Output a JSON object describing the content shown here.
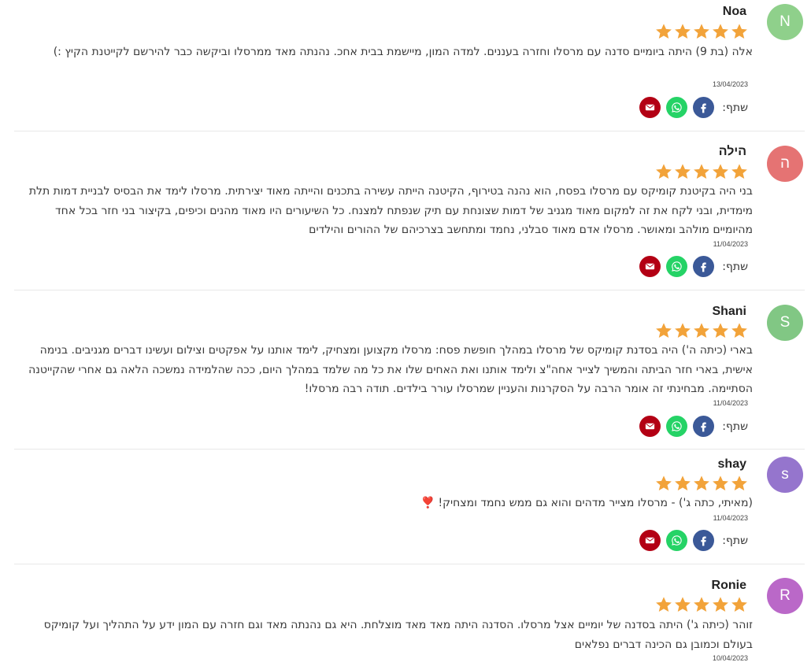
{
  "colors": {
    "star": "#f2a33a",
    "facebook": "#3b5998",
    "whatsapp": "#25d366",
    "email": "#b30014",
    "divider": "#e8e8e8"
  },
  "share_label": "שתף:",
  "reviews": [
    {
      "initial": "N",
      "avatar_color": "#8fd08b",
      "name": "Noa",
      "rating": 5,
      "text": "אלה (בת 9) היתה ביומיים סדנה עם מרסלו וחזרה בעננים. למדה המון, מיישמת בבית אחכ. נהנתה מאד ממרסלו וביקשה כבר להירשם לקייטנת הקיץ :)",
      "date": "13/04/2023"
    },
    {
      "initial": "ה",
      "avatar_color": "#e57373",
      "name": "הילה",
      "rating": 5,
      "text": "בני היה בקיטנת קומיקס עם מרסלו בפסח, הוא נהנה בטירוף, הקיטנה הייתה עשירה בתכנים והייתה מאוד יצירתית. מרסלו לימד את הבסיס לבניית דמות תלת מימדית, ובני לקח את זה למקום מאוד מגניב של דמות שצונחת עם תיק שנפתח למצנח. כל השיעורים היו מאוד מהנים וכיפים, בקיצור בני חזר בכל אחד מהיומיים מולהב ומאושר. מרסלו אדם מאוד סבלני, נחמד ומתחשב בצרכיהם של ההורים והילדים",
      "date": "11/04/2023"
    },
    {
      "initial": "S",
      "avatar_color": "#81c784",
      "name": "Shani",
      "rating": 5,
      "text": "בארי (כיתה ה') היה בסדנת קומיקס של מרסלו במהלך חופשת פסח: מרסלו מקצוען ומצחיק, לימד אותנו על אפקטים וצילום ועשינו דברים מגניבים. בנימה אישית, בארי חזר הביתה והמשיך לצייר אחה\"צ ולימד אותנו ואת האחים שלו את כל מה שלמד במהלך היום, ככה שהלמידה נמשכה הלאה גם אחרי שהקייטנה הסתיימה. מבחינתי זה אומר הרבה על הסקרנות והעניין שמרסלו עורר בילדים. תודה רבה מרסלו!",
      "date": "11/04/2023"
    },
    {
      "initial": "s",
      "avatar_color": "#9575cd",
      "name": "shay",
      "rating": 5,
      "text": "(מאיתי, כתה ג') - מרסלו מצייר מדהים והוא גם ממש נחמד ומצחיק! ❣️",
      "date": "11/04/2023"
    },
    {
      "initial": "R",
      "avatar_color": "#ba68c8",
      "name": "Ronie",
      "rating": 5,
      "text": "זוהר (כיתה ג') היתה בסדנה של יומיים אצל מרסלו. הסדנה היתה מאד מאד מוצלחת. היא גם נהנתה מאד וגם חזרה עם המון ידע על התהליך ועל קומיקס בעולם וכמובן גם הכינה דברים נפלאים",
      "date": "10/04/2023"
    }
  ]
}
